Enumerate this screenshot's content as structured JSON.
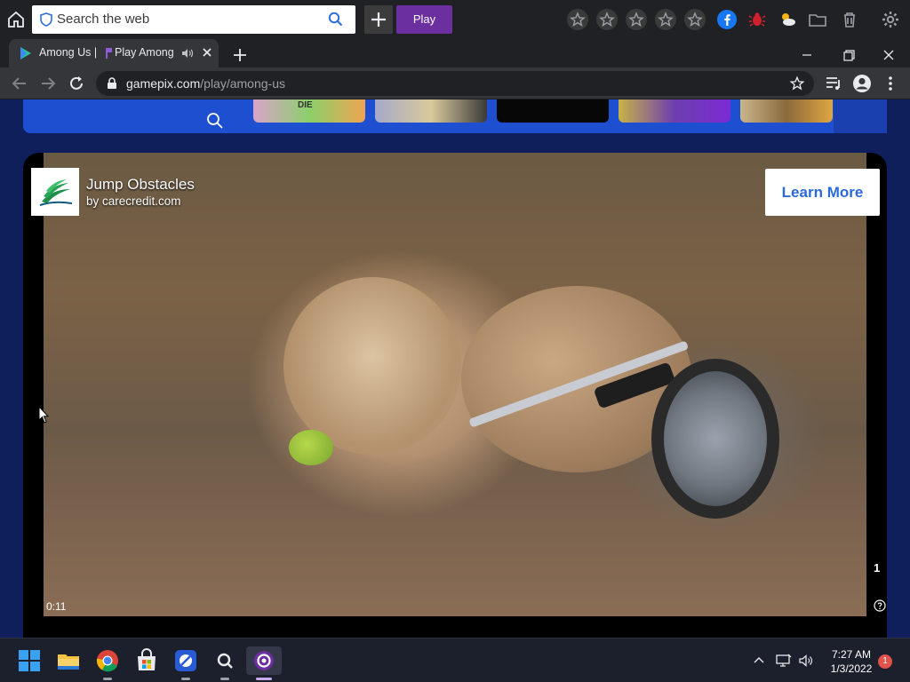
{
  "toolbar": {
    "search_placeholder": "Search the web",
    "play_label": "Play"
  },
  "tabs": [
    {
      "title": "Among Us |"
    },
    {
      "title": "Play Among Us"
    }
  ],
  "address_bar": {
    "url_host": "gamepix.com",
    "url_path": "/play/among-us"
  },
  "game_strip": {
    "thumb_labels": [
      "DIE"
    ]
  },
  "ad": {
    "title": "Jump Obstacles",
    "advertiser": "by carecredit.com",
    "cta": "Learn More",
    "time": "0:11",
    "ad_index": "1"
  },
  "taskbar": {
    "time": "7:27 AM",
    "date": "1/3/2022",
    "notifications": "1"
  },
  "colors": {
    "page_bg": "#0e1f5b",
    "strip_blue": "#1d4fd0",
    "play_purple": "#6b2fa0",
    "cta_text": "#2c6ad8"
  }
}
